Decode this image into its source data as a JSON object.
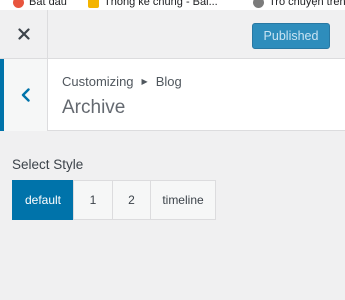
{
  "bookmarks": [
    {
      "label": "Bắt đầu",
      "icon": "firefox-icon"
    },
    {
      "label": "Thống kê chung - Bài...",
      "icon": "folder-icon"
    },
    {
      "label": "Trò chuyện trên",
      "icon": "page-icon"
    }
  ],
  "header": {
    "close_icon": "close-icon",
    "publish_label": "Published"
  },
  "section": {
    "breadcrumb": {
      "parent": "Customizing",
      "child": "Blog"
    },
    "title": "Archive",
    "back_icon": "chevron-left-icon"
  },
  "control": {
    "label": "Select Style",
    "options": [
      "default",
      "1",
      "2",
      "timeline"
    ],
    "selected": "default"
  },
  "colors": {
    "accent": "#0073aa",
    "publish_bg": "#2e8dbc"
  }
}
